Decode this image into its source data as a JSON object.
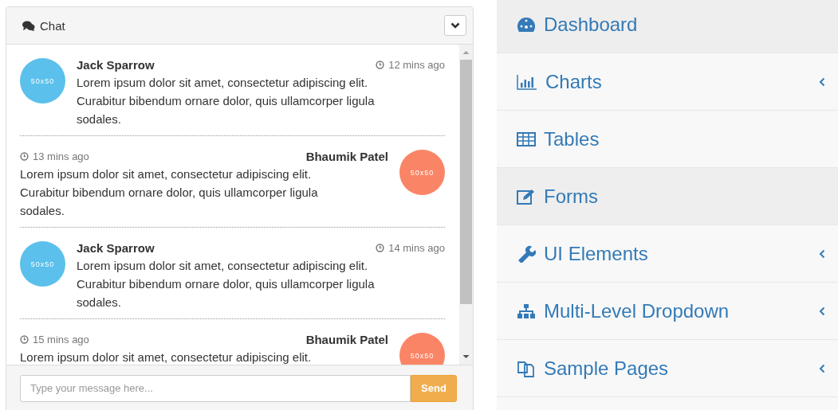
{
  "chat": {
    "title": "Chat",
    "messages": [
      {
        "kind": "incoming",
        "author": "Jack Sparrow",
        "time": "12 mins ago",
        "avatar": "50x50",
        "color": "#5bc0eb",
        "text": "Lorem ipsum dolor sit amet, consectetur adipiscing elit. Curabitur bibendum ornare dolor, quis ullamcorper ligula sodales."
      },
      {
        "kind": "outgoing",
        "author": "Bhaumik Patel",
        "time": "13 mins ago",
        "avatar": "50x50",
        "color": "#fa8566",
        "text": "Lorem ipsum dolor sit amet, consectetur adipiscing elit. Curabitur bibendum ornare dolor, quis ullamcorper ligula sodales."
      },
      {
        "kind": "incoming",
        "author": "Jack Sparrow",
        "time": "14 mins ago",
        "avatar": "50x50",
        "color": "#5bc0eb",
        "text": "Lorem ipsum dolor sit amet, consectetur adipiscing elit. Curabitur bibendum ornare dolor, quis ullamcorper ligula sodales."
      },
      {
        "kind": "outgoing",
        "author": "Bhaumik Patel",
        "time": "15 mins ago",
        "avatar": "50x50",
        "color": "#fa8566",
        "text": "Lorem ipsum dolor sit amet, consectetur adipiscing elit."
      }
    ],
    "input": {
      "placeholder": "Type your message here..."
    },
    "send_button": "Send"
  },
  "sidebar": {
    "items": [
      {
        "kind": "dashboard",
        "label": "Dashboard",
        "active": true,
        "has_submenu": false
      },
      {
        "kind": "chart",
        "label": "Charts",
        "active": false,
        "has_submenu": true
      },
      {
        "kind": "table",
        "label": "Tables",
        "active": false,
        "has_submenu": false
      },
      {
        "kind": "edit",
        "label": "Forms",
        "active": true,
        "has_submenu": false
      },
      {
        "kind": "wrench",
        "label": "UI Elements",
        "active": false,
        "has_submenu": true
      },
      {
        "kind": "sitemap",
        "label": "Multi-Level Dropdown",
        "active": false,
        "has_submenu": true
      },
      {
        "kind": "files",
        "label": "Sample Pages",
        "active": false,
        "has_submenu": true
      }
    ]
  }
}
